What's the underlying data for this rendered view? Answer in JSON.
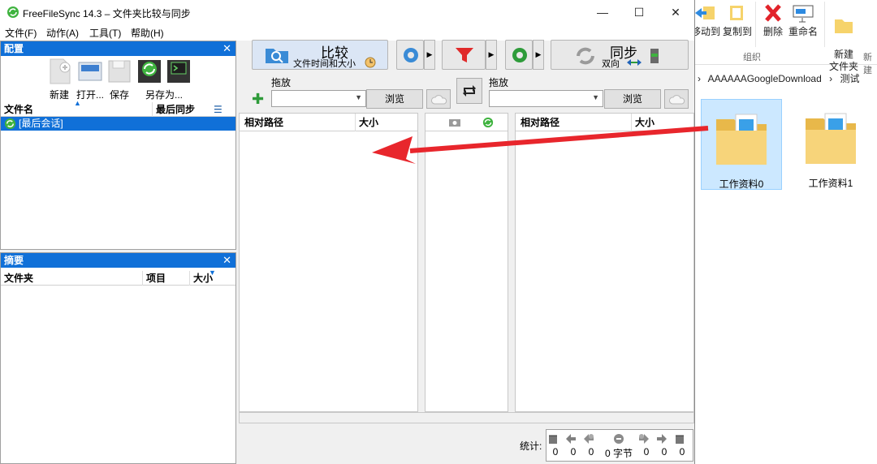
{
  "window": {
    "title": "FreeFileSync 14.3 – 文件夹比较与同步",
    "minimize": "—",
    "maximize": "☐",
    "close": "✕"
  },
  "menu": [
    "文件(F)",
    "动作(A)",
    "工具(T)",
    "帮助(H)"
  ],
  "config_panel": {
    "title": "配置",
    "close": "✕",
    "buttons": [
      "新建",
      "打开...",
      "保存",
      "另存为..."
    ],
    "columns": {
      "name": "文件名",
      "last_sync": "最后同步"
    },
    "rows": [
      "[最后会话]"
    ]
  },
  "summary_panel": {
    "title": "摘要",
    "close": "✕",
    "columns": {
      "folder": "文件夹",
      "items": "项目",
      "size": "大小"
    }
  },
  "toolbar": {
    "compare_label": "比较",
    "compare_sub": "文件时间和大小",
    "sync_label": "同步",
    "sync_sub": "双向"
  },
  "paths": {
    "left_label": "拖放",
    "right_label": "拖放",
    "left_value": "",
    "right_value": "",
    "browse": "浏览"
  },
  "grid": {
    "left": {
      "path": "相对路径",
      "size": "大小"
    },
    "right": {
      "path": "相对路径",
      "size": "大小"
    }
  },
  "status": {
    "label": "统计:",
    "counts": [
      "0",
      "0",
      "0",
      "0",
      "0",
      "0",
      "0"
    ],
    "bytes": "0 字节"
  },
  "explorer": {
    "ribbon": [
      "移动到",
      "复制到",
      "删除",
      "重命名",
      "新建\n文件夹"
    ],
    "group_label": "组织",
    "group_label2": "新建",
    "breadcrumb": [
      "AAAAAAGoogleDownload",
      "测试"
    ],
    "folders": [
      "工作资料0",
      "工作资料1"
    ]
  },
  "colors": {
    "accent": "#1070d8",
    "arrow": "#e8262c"
  }
}
